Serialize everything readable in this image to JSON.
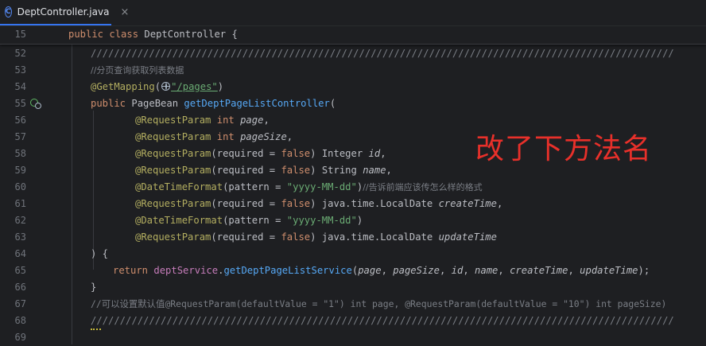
{
  "tab": {
    "icon_letter": "C",
    "file_name": "DeptController.java",
    "close": "×"
  },
  "sticky": {
    "line_number": "15",
    "kw_public": "public",
    "kw_class": "class",
    "class_name": "DeptController",
    "brace": "{"
  },
  "lines": {
    "l52": {
      "n": "52",
      "slashes": "////////////////////////////////////////////////////////////////////////////////////////////////////"
    },
    "l53": {
      "n": "53",
      "comment": "//分页查询获取列表数据"
    },
    "l54": {
      "n": "54",
      "ann": "@GetMapping",
      "open": "(",
      "path": "\"/pages\"",
      "close": ")"
    },
    "l55": {
      "n": "55",
      "kw": "public",
      "type": "PageBean",
      "method": "getDeptPageListController",
      "open": "("
    },
    "l56": {
      "n": "56",
      "ann": "@RequestParam",
      "type": "int",
      "name": "page",
      "punct": ","
    },
    "l57": {
      "n": "57",
      "ann": "@RequestParam",
      "type": "int",
      "name": "pageSize",
      "punct": ","
    },
    "l58": {
      "n": "58",
      "ann": "@RequestParam",
      "args_a": "(required = ",
      "bool": "false",
      "args_b": ") Integer ",
      "name": "id",
      "punct": ","
    },
    "l59": {
      "n": "59",
      "ann": "@RequestParam",
      "args_a": "(required = ",
      "bool": "false",
      "args_b": ") String ",
      "name": "name",
      "punct": ","
    },
    "l60": {
      "n": "60",
      "ann": "@DateTimeFormat",
      "args_a": "(pattern = ",
      "str": "\"yyyy-MM-dd\"",
      "args_b": ")",
      "comment": "//告诉前端应该传怎么样的格式"
    },
    "l61": {
      "n": "61",
      "ann": "@RequestParam",
      "args_a": "(required = ",
      "bool": "false",
      "args_b": ") java.time.LocalDate ",
      "name": "createTime",
      "punct": ","
    },
    "l62": {
      "n": "62",
      "ann": "@DateTimeFormat",
      "args_a": "(pattern = ",
      "str": "\"yyyy-MM-dd\"",
      "args_b": ")"
    },
    "l63": {
      "n": "63",
      "ann": "@RequestParam",
      "args_a": "(required = ",
      "bool": "false",
      "args_b": ") java.time.LocalDate ",
      "name": "updateTime"
    },
    "l64": {
      "n": "64",
      "text": ") {"
    },
    "l65": {
      "n": "65",
      "kw": "return",
      "field": "deptService",
      "dot": ".",
      "method": "getDeptPageListService",
      "open": "(",
      "a1": "page",
      "sep1": ", ",
      "a2": "pageSize",
      "sep2": ", ",
      "a3": "id",
      "sep3": ", ",
      "a4": "name",
      "sep4": ", ",
      "a5": "createTime",
      "sep5": ", ",
      "a6": "updateTime",
      "close": ");"
    },
    "l66": {
      "n": "66",
      "text": "}"
    },
    "l67": {
      "n": "67",
      "comment": "//可以设置默认值@RequestParam(defaultValue = \"1\") int page, @RequestParam(defaultValue = \"10\") int pageSize)"
    },
    "l68": {
      "n": "68",
      "slashes": "////////////////////////////////////////////////////////////////////////////////////////////////////"
    },
    "l69": {
      "n": "69"
    }
  },
  "overlay_note": "改了下方法名",
  "colors": {
    "background": "#1e1f22",
    "keyword": "#cf8e6d",
    "annotation": "#b3ae60",
    "string": "#6aab73",
    "comment": "#7a7e85",
    "method": "#56a8f5",
    "field": "#c77dbb",
    "overlay_text": "#e8302a"
  }
}
